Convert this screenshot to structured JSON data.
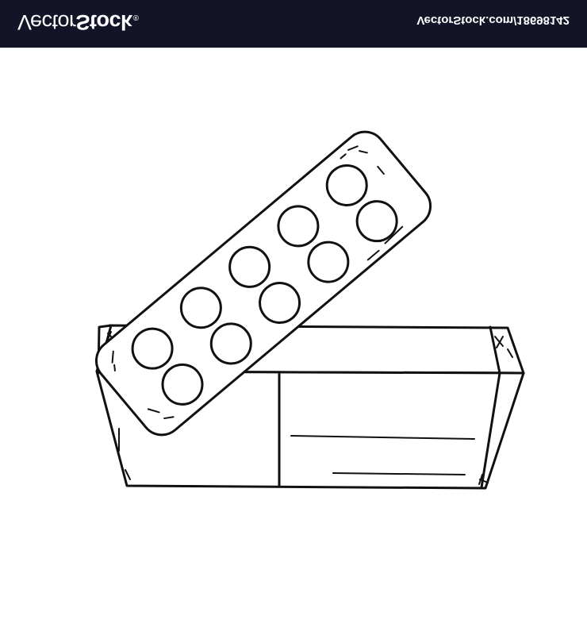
{
  "watermark": {
    "brand_light": "Vector",
    "brand_bold": "Stock",
    "registered": "®",
    "credit": "VectorStock.com/18698142",
    "background_color": "#131428",
    "text_color": "#ffffff"
  },
  "illustration": {
    "tablet_count": 10,
    "line_color": "#111111",
    "fill_color": "#ffffff"
  }
}
